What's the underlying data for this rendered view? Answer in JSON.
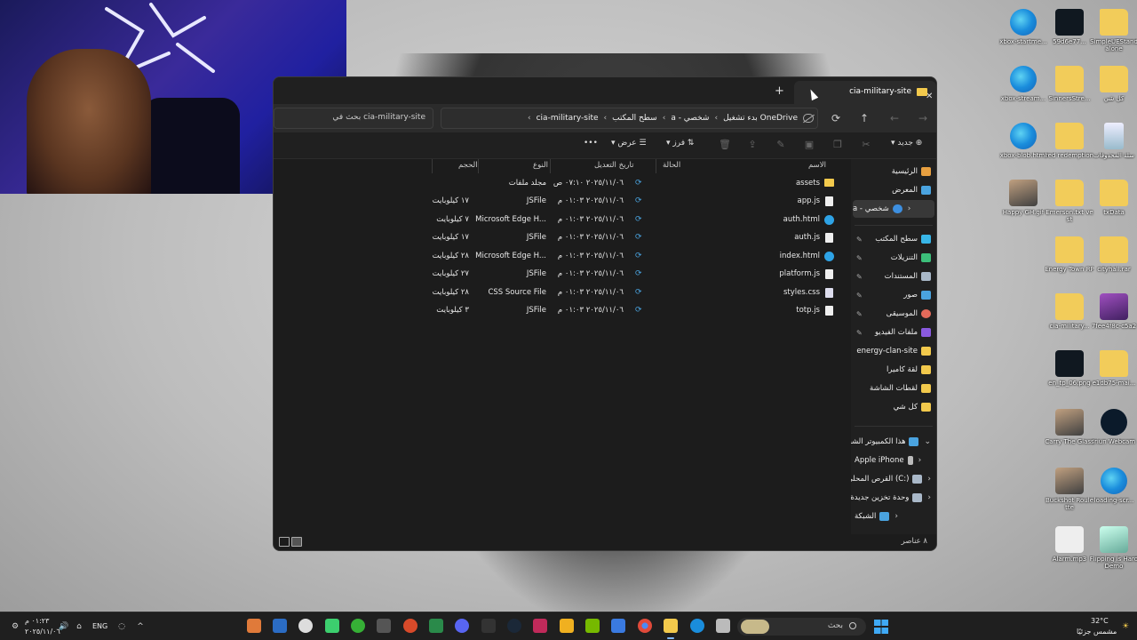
{
  "window": {
    "tab_title": "cia-military-site",
    "new_tab": "+",
    "close_tab": "✕"
  },
  "address": {
    "crumbs": [
      "cia-military-site",
      "سطح المكتب",
      "a - شخصي",
      "بدء تشغيل OneDrive"
    ],
    "search_placeholder": "بحث في cia-military-site"
  },
  "toolbar": {
    "new_label": "جديد",
    "sort_label": "فرز",
    "view_label": "عرض",
    "more_label": "•••"
  },
  "columns": {
    "name": "الاسم",
    "status": "الحالة",
    "modified": "تاريخ التعديل",
    "type": "النوع",
    "size": "الحجم"
  },
  "files": [
    {
      "name": "assets",
      "modified": "٢٠٢٥/١١/٠٦ ٠٧:١٠ ص",
      "type": "مجلد ملفات",
      "size": "",
      "icon": "folder"
    },
    {
      "name": "app.js",
      "modified": "٢٠٢٥/١١/٠٦ ٠١:٠٣ م",
      "type": "JSFile",
      "size": "١٧ كيلوبايت",
      "icon": "file"
    },
    {
      "name": "auth.html",
      "modified": "٢٠٢٥/١١/٠٦ ٠١:٠٣ م",
      "type": "Microsoft Edge H...",
      "size": "٧ كيلوبايت",
      "icon": "edge"
    },
    {
      "name": "auth.js",
      "modified": "٢٠٢٥/١١/٠٦ ٠١:٠٣ م",
      "type": "JSFile",
      "size": "١٧ كيلوبايت",
      "icon": "file"
    },
    {
      "name": "index.html",
      "modified": "٢٠٢٥/١١/٠٦ ٠١:٠٣ م",
      "type": "Microsoft Edge H...",
      "size": "٢٨ كيلوبايت",
      "icon": "edge"
    },
    {
      "name": "platform.js",
      "modified": "٢٠٢٥/١١/٠٦ ٠١:٠٣ م",
      "type": "JSFile",
      "size": "٢٧ كيلوبايت",
      "icon": "file"
    },
    {
      "name": "styles.css",
      "modified": "٢٠٢٥/١١/٠٦ ٠١:٠٣ م",
      "type": "CSS Source File",
      "size": "٢٨ كيلوبايت",
      "icon": "css"
    },
    {
      "name": "totp.js",
      "modified": "٢٠٢٥/١١/٠٦ ٠١:٠٣ م",
      "type": "JSFile",
      "size": "٣ كيلوبايت",
      "icon": "file"
    }
  ],
  "sidebar": {
    "items": [
      {
        "label": "الرئيسية",
        "color": "#e8a040"
      },
      {
        "label": "المعرض",
        "color": "#4aa3df"
      },
      {
        "label": "a - شخصي",
        "color": "#3d8fe0"
      },
      {
        "label": "سطح المكتب",
        "color": "#38b6e8"
      },
      {
        "label": "التنزيلات",
        "color": "#3cbf7a"
      },
      {
        "label": "المستندات",
        "color": "#a9b8c8"
      },
      {
        "label": "صور",
        "color": "#4aa3df"
      },
      {
        "label": "الموسيقى",
        "color": "#e46a5a"
      },
      {
        "label": "ملفات الفيديو",
        "color": "#8a5ae0"
      },
      {
        "label": "energy-clan-site",
        "color": "#f2c94c"
      },
      {
        "label": "لقة كاميرا",
        "color": "#f2c94c"
      },
      {
        "label": "لقطات الشاشة",
        "color": "#f2c94c"
      },
      {
        "label": "كل شي",
        "color": "#f2c94c"
      },
      {
        "label": "هذا الكمبيوتر الشخصي",
        "color": "#4aa3df"
      },
      {
        "label": "Apple iPhone",
        "color": "#bbbbbb"
      },
      {
        "label": "القرص المحلي (C:)",
        "color": "#a9b8c8"
      },
      {
        "label": "وحدة تخزين جديدة",
        "color": "#a9b8c8"
      },
      {
        "label": "الشبكة",
        "color": "#4aa3df"
      }
    ]
  },
  "status": {
    "count": "٨ عناصر"
  },
  "desktop": {
    "icons": [
      {
        "label": "SimpleUEStandalone",
        "glyph": "folder"
      },
      {
        "label": "59d6e77...",
        "glyph": "dark"
      },
      {
        "label": "xbox-startme...",
        "glyph": "edge"
      },
      {
        "label": "كل شي",
        "glyph": "folder"
      },
      {
        "label": "SinnersStre...",
        "glyph": "folder"
      },
      {
        "label": "xbox-stream...",
        "glyph": "edge"
      },
      {
        "label": "سلة المحذوفات",
        "glyph": "bin"
      },
      {
        "label": "red redemption",
        "glyph": "folder"
      },
      {
        "label": "xbox-blob.html",
        "glyph": "edge"
      },
      {
        "label": "txData",
        "glyph": "folder"
      },
      {
        "label": "Emerson.txt vest",
        "glyph": "folder"
      },
      {
        "label": "Happy GH.gif",
        "glyph": "photo"
      },
      {
        "label": "cityhall.rar",
        "glyph": "folder"
      },
      {
        "label": "Energy Town RP",
        "glyph": "folder"
      },
      {
        "label": "7fee4f8c-c5a2",
        "glyph": "purple"
      },
      {
        "label": "cia-military...",
        "glyph": "folder"
      },
      {
        "label": "e1db75-mai...",
        "glyph": "folder"
      },
      {
        "label": "en_tp_06.png",
        "glyph": "dark"
      },
      {
        "label": "Iriun Webcam",
        "glyph": "webcam"
      },
      {
        "label": "Carry The Glass",
        "glyph": "photo"
      },
      {
        "label": "loading-scr...",
        "glyph": "edge"
      },
      {
        "label": "Buckshot Roulette",
        "glyph": "photo"
      },
      {
        "label": "Flipping is Hard Demo",
        "glyph": "card"
      },
      {
        "label": "Alarm.mp3",
        "glyph": "audio"
      }
    ]
  },
  "taskbar": {
    "search_placeholder": "بحث",
    "language": "ENG",
    "time": "٠١:٢٣ م",
    "date": "٢٠٢٥/١١/٠٦",
    "weather_temp": "32°C",
    "weather_desc": "مشمس جزئيًا"
  }
}
